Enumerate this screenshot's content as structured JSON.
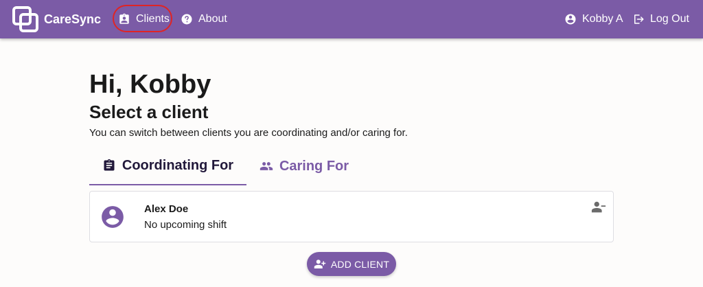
{
  "app": {
    "name": "CareSync",
    "logo_icon": "caresync-logo-icon"
  },
  "colors": {
    "primary": "#7b5ba6",
    "tab_active_text": "#21183a",
    "highlight_ring": "#e02424",
    "page_background": "#fdfcfb"
  },
  "nav": {
    "clients": {
      "label": "Clients",
      "icon": "clipboard-account-icon"
    },
    "about": {
      "label": "About",
      "icon": "help-circle-icon"
    },
    "user": {
      "label": "Kobby A",
      "icon": "account-circle-icon"
    },
    "logout": {
      "label": "Log Out",
      "icon": "logout-icon"
    }
  },
  "main": {
    "greeting": "Hi, Kobby",
    "heading": "Select a client",
    "description": "You can switch between clients you are coordinating and/or caring for."
  },
  "tabs": [
    {
      "label": "Coordinating For",
      "icon": "clipboard-list-icon",
      "active": true
    },
    {
      "label": "Caring For",
      "icon": "people-icon",
      "active": false
    }
  ],
  "clients": [
    {
      "name": "Alex Doe",
      "status": "No upcoming shift",
      "avatar_icon": "account-circle-icon",
      "action_icon": "person-remove-icon"
    }
  ],
  "actions": {
    "add_client_label": "ADD CLIENT",
    "add_client_icon": "person-add-icon"
  }
}
